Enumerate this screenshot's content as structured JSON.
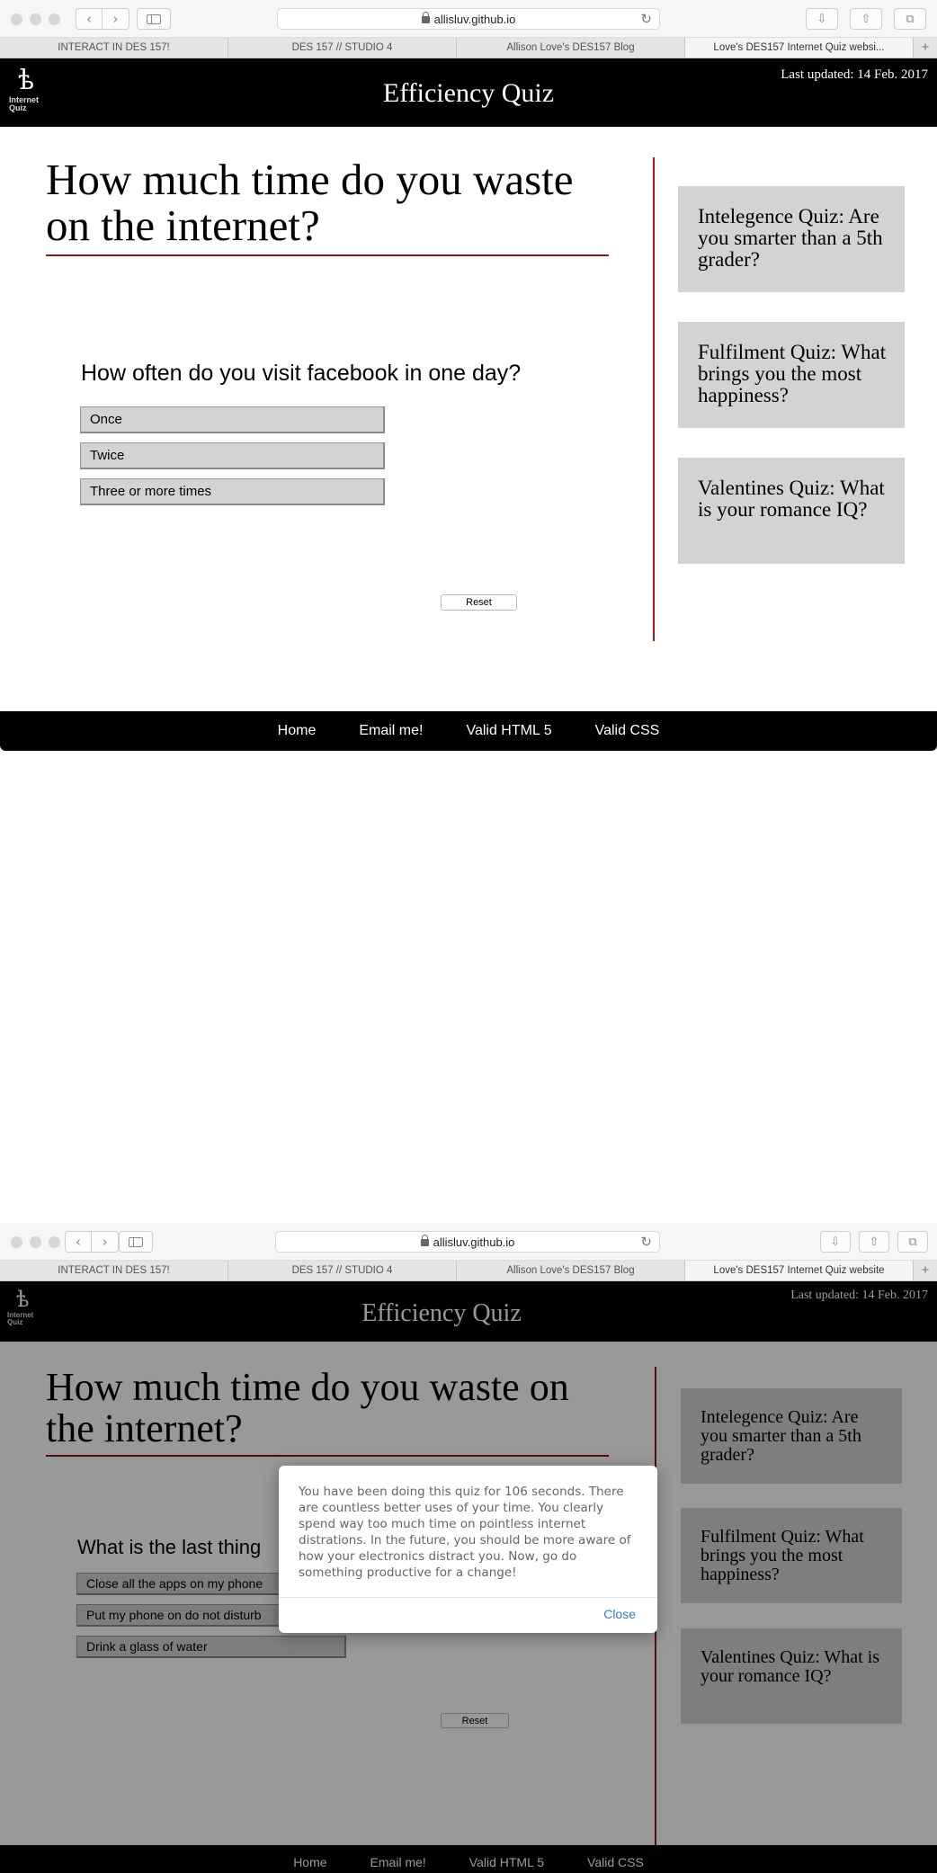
{
  "browser": {
    "url": "allisluv.github.io",
    "tabs_top": [
      "INTERACT IN DES 157!",
      "DES 157 // STUDIO 4",
      "Allison Love's DES157 Blog",
      "Love's DES157 Internet Quiz websi..."
    ],
    "tabs_bottom": [
      "INTERACT IN DES 157!",
      "DES 157 // STUDIO 4",
      "Allison Love's DES157 Blog",
      "Love's DES157 Internet Quiz website"
    ],
    "new_tab": "+"
  },
  "site": {
    "logo_line1": "Internet",
    "logo_line2": "Quiz",
    "title": "Efficiency Quiz",
    "last_updated": "Last updated: 14 Feb. 2017"
  },
  "quiz": {
    "heading": "How much time do you waste on the internet?",
    "reset_label": "Reset"
  },
  "screen1": {
    "question": "How often do you visit facebook in one day?",
    "answers": [
      "Once",
      "Twice",
      "Three or more times"
    ]
  },
  "screen2": {
    "question": "What is the last thing",
    "answers": [
      "Close all the apps on my phone",
      "Put my phone on do not disturb",
      "Drink a glass of water"
    ]
  },
  "sidebar": {
    "cards": [
      "Intelegence Quiz: Are you smarter than a 5th grader?",
      "Fulfilment Quiz: What brings you the most happiness?",
      "Valentines Quiz: What is your romance IQ?"
    ]
  },
  "footer": {
    "links": [
      "Home",
      "Email me!",
      "Valid HTML 5",
      "Valid CSS"
    ]
  },
  "modal": {
    "message": "You have been doing this quiz for 106 seconds. There are countless better uses of your time. You clearly spend way too much time on pointless internet distrations. In the future, you should be more aware of how your electronics distract you. Now, go do something productive for a change!",
    "close_label": "Close"
  }
}
